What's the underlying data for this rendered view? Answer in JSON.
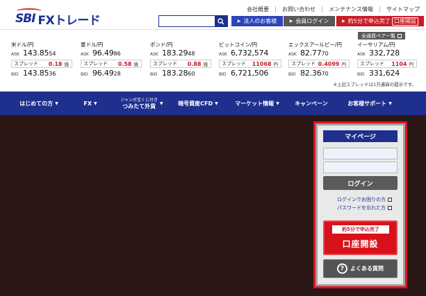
{
  "brand": {
    "sbi": "SBI",
    "fx": "FXトレード"
  },
  "header": {
    "links": [
      "会社概要",
      "お問い合わせ",
      "メンテナンス情報",
      "サイトマップ"
    ],
    "search_placeholder": "",
    "corp_label": "法人のお客様",
    "login_label": "会員ログイン",
    "open_label": "約5分で申込完了",
    "open_kouza": "口座開設"
  },
  "rates": {
    "all_pairs_label": "全通貨ペア一覧",
    "ask_label": "ASK",
    "bid_label": "BID",
    "spread_label": "スプレッド",
    "items": [
      {
        "pair": "米ドル/円",
        "ask_big": "143.85",
        "ask_small": "54",
        "spread": "0.18",
        "unit": "銭",
        "bid_big": "143.85",
        "bid_small": "36"
      },
      {
        "pair": "豪ドル/円",
        "ask_big": "96.49",
        "ask_small": "86",
        "spread": "0.58",
        "unit": "銭",
        "bid_big": "96.49",
        "bid_small": "28"
      },
      {
        "pair": "ポンド/円",
        "ask_big": "183.29",
        "ask_small": "48",
        "spread": "0.88",
        "unit": "銭",
        "bid_big": "183.28",
        "bid_small": "60"
      },
      {
        "pair": "ビットコイン/円",
        "ask_big": "6,732,574",
        "ask_small": "",
        "spread": "11068",
        "unit": "円",
        "bid_big": "6,721,506",
        "bid_small": ""
      },
      {
        "pair": "エックスアールピー/円",
        "ask_big": "82.77",
        "ask_small": "70",
        "spread": "0.4099",
        "unit": "円",
        "bid_big": "82.36",
        "bid_small": "70"
      },
      {
        "pair": "イーサリアム/円",
        "ask_big": "332,728",
        "ask_small": "",
        "spread": "1104",
        "unit": "円",
        "bid_big": "331,624",
        "bid_small": ""
      }
    ],
    "note": "※上記スプレッドは1万通貨の提示です。"
  },
  "nav": {
    "items": [
      {
        "label": "はじめての方"
      },
      {
        "label": "FX"
      },
      {
        "tiny": "ジャンボ宝くじ付き",
        "label": "つみたて外貨"
      },
      {
        "label": "暗号資産CFD"
      },
      {
        "label": "マーケット情報"
      },
      {
        "label": "キャンペーン"
      },
      {
        "label": "お客様サポート"
      }
    ]
  },
  "mypage": {
    "title": "マイページ",
    "id_placeholder": "",
    "pw_placeholder": "",
    "login_label": "ログイン",
    "trouble_link": "ログインでお困りの方",
    "forgot_link": "パスワードを忘れた方",
    "open_tag": "約5分で申込完了",
    "open_label": "口座開設",
    "faq_label": "よくある質問"
  }
}
